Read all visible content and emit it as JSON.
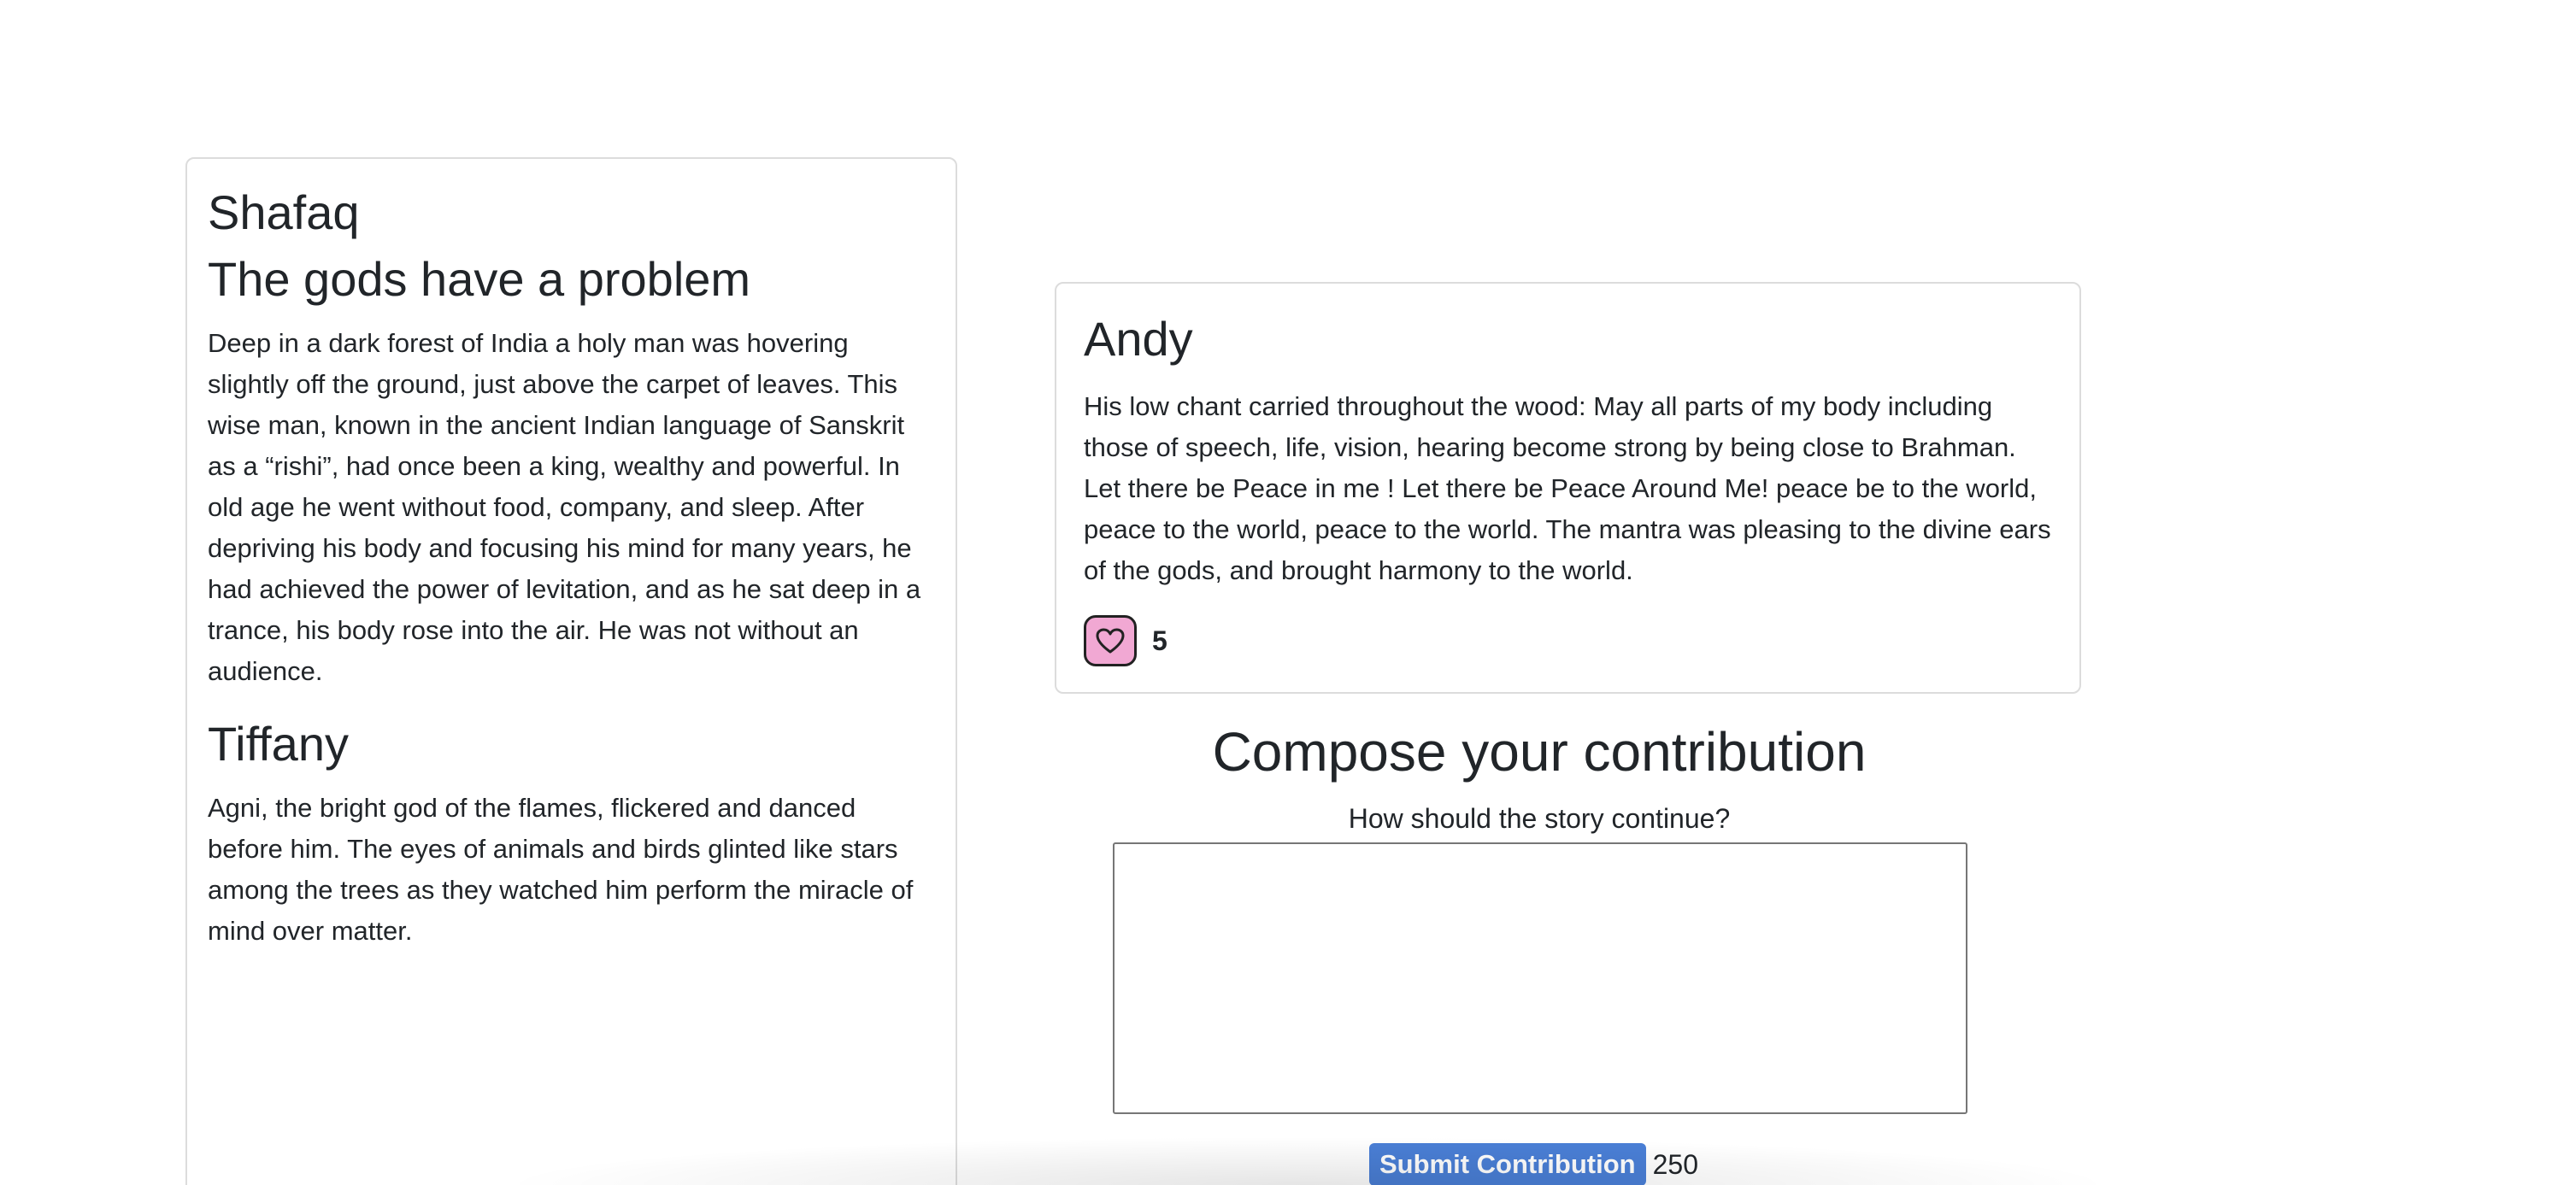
{
  "story_card": {
    "first_author": "Shafaq",
    "title": "The gods have a problem",
    "first_text": "Deep in a dark forest of India a holy man was hovering slightly off the ground, just above the carpet of leaves. This wise man, known in the ancient Indian language of Sanskrit as a “rishi”, had once been a king, wealthy and powerful. In old age he went without food, company, and sleep. After depriving his body and focusing his mind for many years, he had achieved the power of levitation, and as he sat deep in a trance, his body rose into the air. He was not without an audience.",
    "second_author": "Tiffany",
    "second_text": "Agni, the bright god of the flames, flickered and danced before him. The eyes of animals and birds glinted like stars among the trees as they watched him perform the miracle of mind over matter."
  },
  "contribution_card": {
    "author": "Andy",
    "text": "His low chant carried throughout the wood: May all parts of my body including those of speech, life, vision, hearing become strong by being close to Brahman. Let there be Peace in me ! Let there be Peace Around Me! peace be to the world, peace to the world, peace to the world. The mantra was pleasing to the divine ears of the gods, and brought harmony to the world.",
    "like_icon": "heart-icon",
    "like_count": "5"
  },
  "compose": {
    "heading": "Compose your contribution",
    "prompt": "How should the story continue?",
    "textarea_value": "",
    "submit_label": "Submit Contribution",
    "char_count": "250"
  },
  "colors": {
    "like_button_bg": "#f1a8d3",
    "submit_bg": "#4a7fd6"
  }
}
